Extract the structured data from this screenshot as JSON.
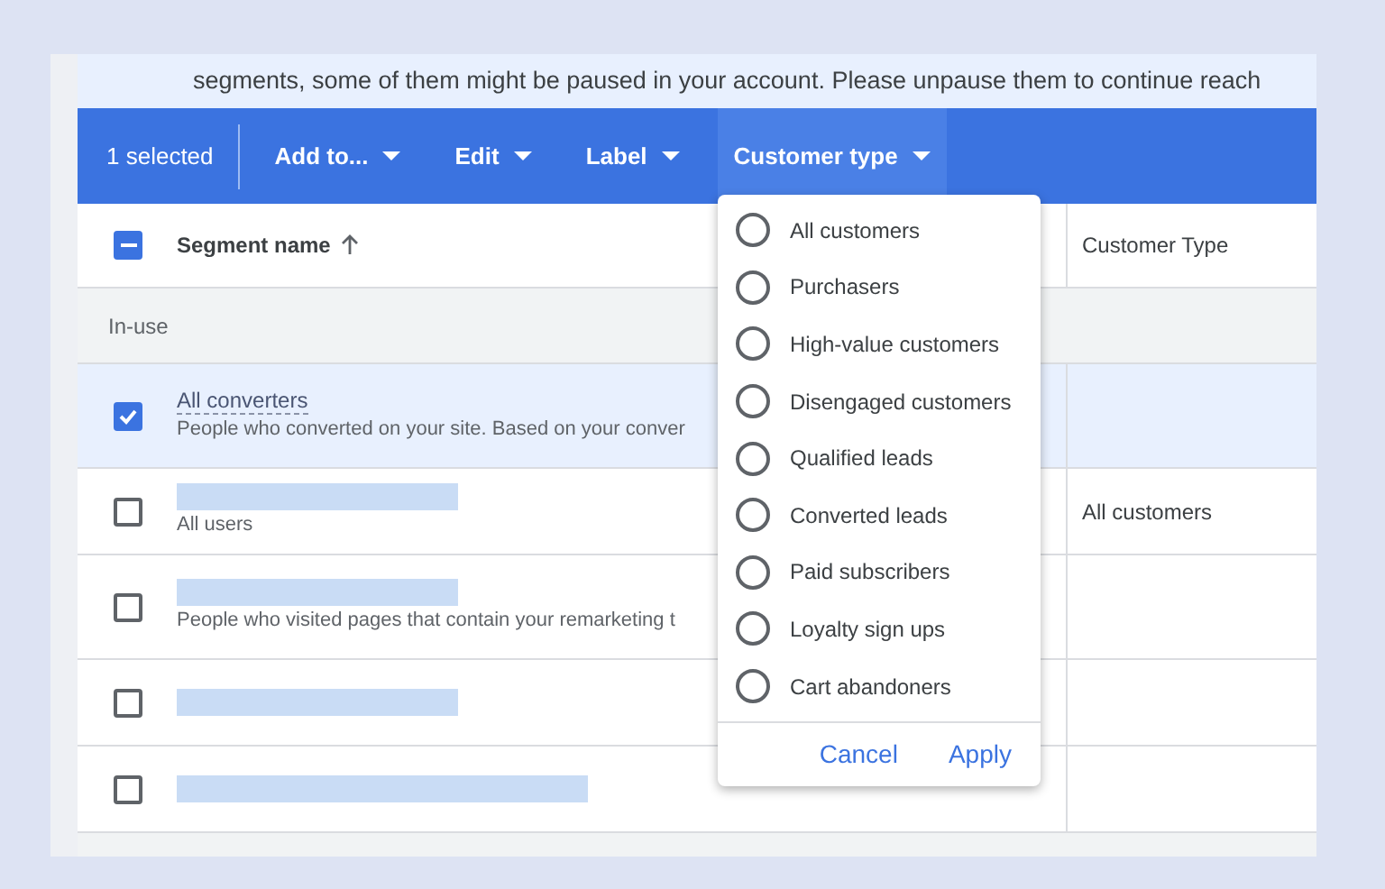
{
  "banner": {
    "text": "segments, some of them might be paused in your account. Please unpause them to continue reach"
  },
  "toolbar": {
    "selection_count": "1 selected",
    "menus": [
      {
        "label": "Add to...",
        "open": false
      },
      {
        "label": "Edit",
        "open": false
      },
      {
        "label": "Label",
        "open": false
      },
      {
        "label": "Customer type",
        "open": true
      }
    ]
  },
  "table": {
    "header_checkbox_partial": true,
    "columns": [
      {
        "label": "Segment name",
        "sorted_ascending": true
      },
      {
        "label": "Customer Type"
      }
    ],
    "group_label": "In-use",
    "rows": [
      {
        "kind": "named",
        "name": "All converters",
        "description": "People who converted on your site. Based on your conver",
        "selected": true
      },
      {
        "kind": "redacted",
        "description": "All users",
        "customer_type": "All customers",
        "selected": false
      },
      {
        "kind": "redacted",
        "description": "People who visited pages that contain your remarketing t",
        "selected": false
      },
      {
        "kind": "redacted",
        "selected": false
      },
      {
        "kind": "redacted",
        "wide": true,
        "selected": false
      }
    ]
  },
  "customer_type_menu": {
    "options": [
      {
        "label": "All customers",
        "selected": false
      },
      {
        "label": "Purchasers",
        "selected": false
      },
      {
        "label": "High-value customers",
        "selected": false
      },
      {
        "label": "Disengaged customers",
        "selected": false
      },
      {
        "label": "Qualified leads",
        "selected": false
      },
      {
        "label": "Converted leads",
        "selected": false
      },
      {
        "label": "Paid subscribers",
        "selected": false
      },
      {
        "label": "Loyalty sign ups",
        "selected": false
      },
      {
        "label": "Cart abandoners",
        "selected": false
      }
    ],
    "buttons": [
      "Cancel",
      "Apply"
    ]
  }
}
